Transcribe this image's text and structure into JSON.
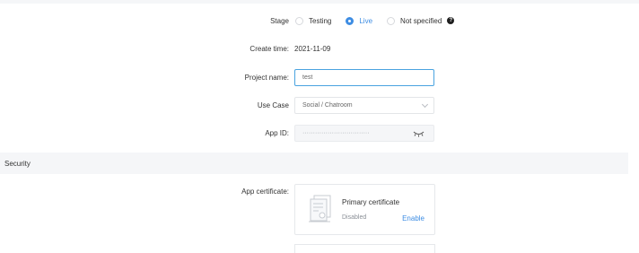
{
  "stage": {
    "label": "Stage",
    "options": [
      "Testing",
      "Live",
      "Not specified"
    ],
    "selected": "Live",
    "help_icon": "question-circle-icon"
  },
  "create_time": {
    "label": "Create time:",
    "value": "2021-11-09"
  },
  "project_name": {
    "label": "Project name:",
    "value": "test"
  },
  "use_case": {
    "label": "Use Case",
    "value": "Social / Chatroom",
    "icon": "chevron-down-icon"
  },
  "app_id": {
    "label": "App ID:",
    "masked_value": "································",
    "icon": "eye-closed-icon"
  },
  "security": {
    "title": "Security"
  },
  "app_certificate": {
    "label": "App certificate:",
    "card": {
      "title": "Primary certificate",
      "status": "Disabled",
      "action": "Enable",
      "icon": "certificate-icon"
    }
  },
  "colors": {
    "accent": "#3e8de3",
    "section_bg": "#f5f6f8",
    "border": "#e3e5e8"
  }
}
